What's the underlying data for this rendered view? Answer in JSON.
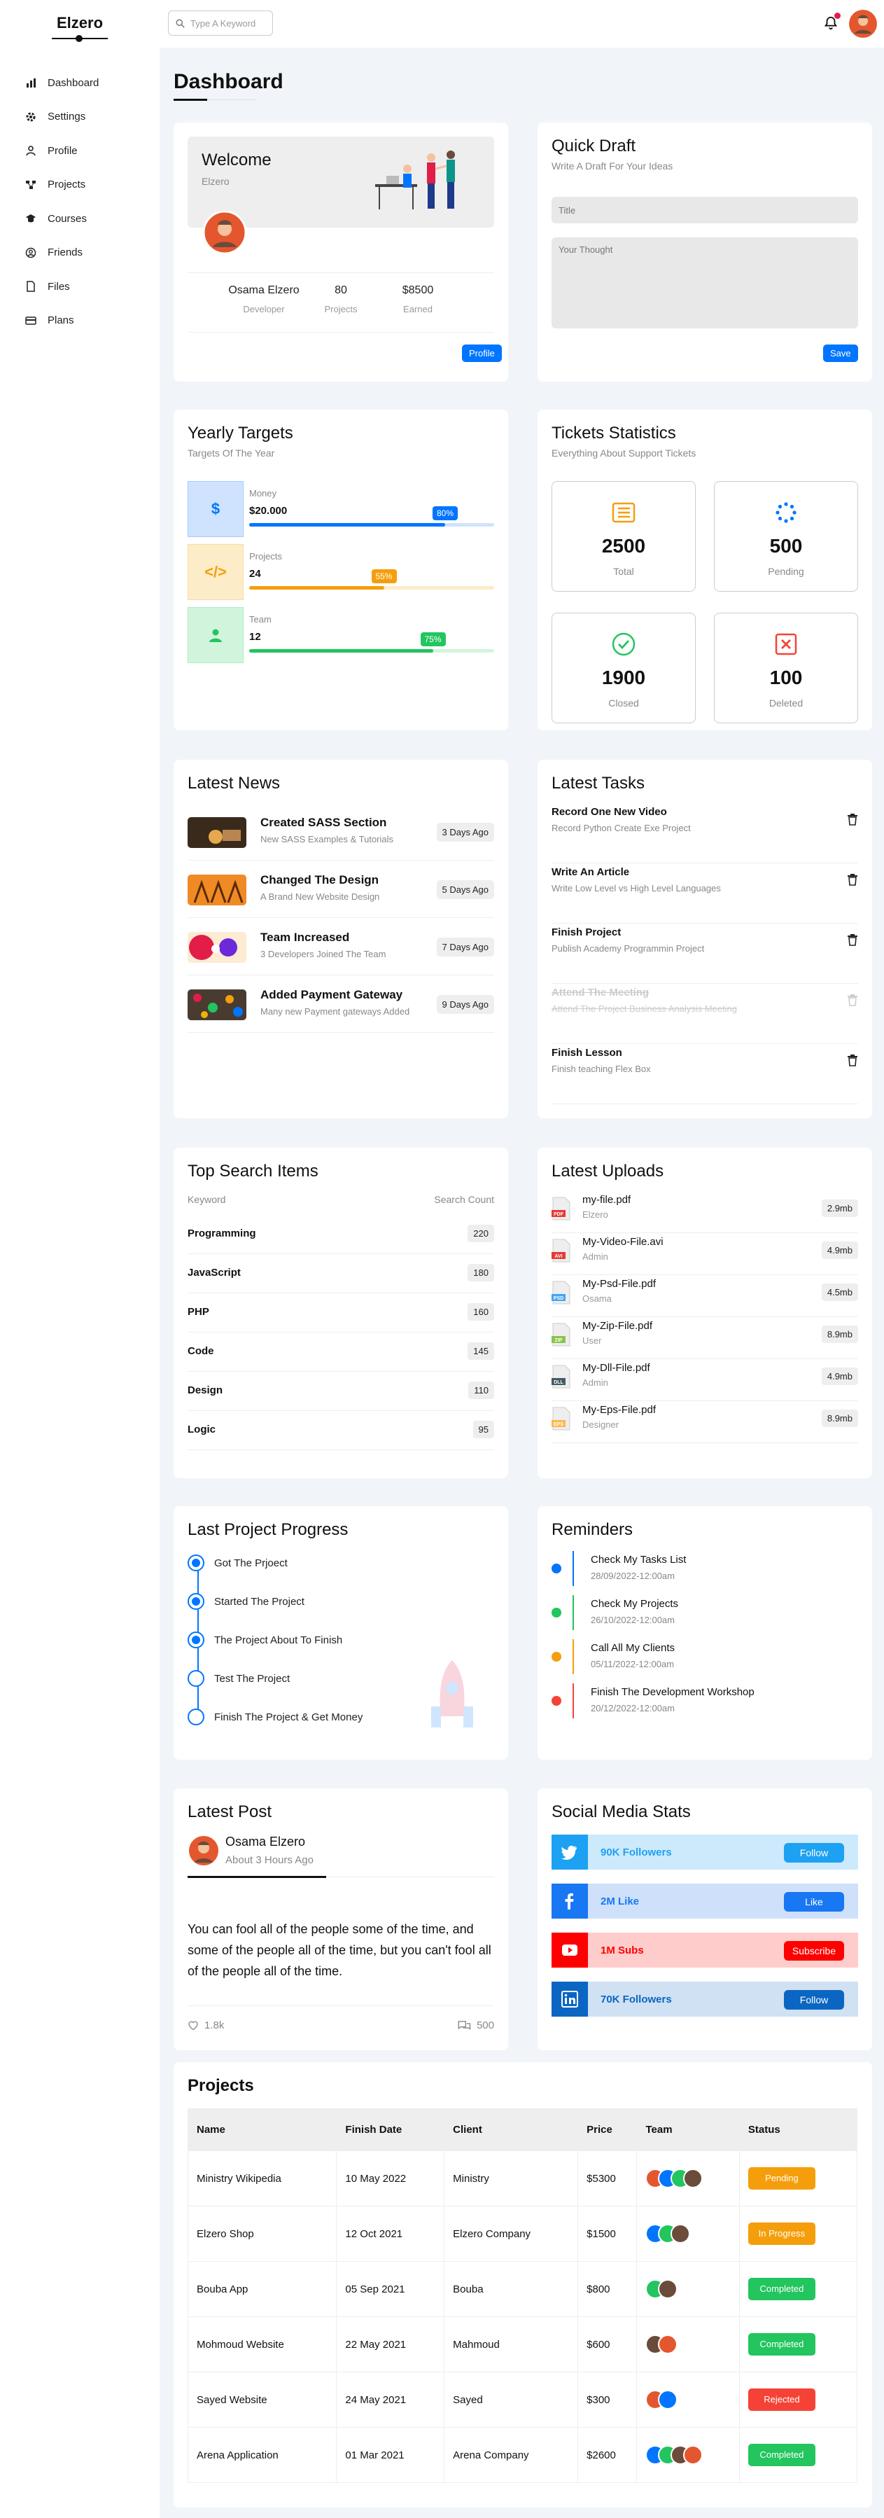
{
  "brand": "Elzero",
  "sidebar": {
    "items": [
      {
        "label": "Dashboard",
        "icon": "chart-bar-icon"
      },
      {
        "label": "Settings",
        "icon": "gear-icon"
      },
      {
        "label": "Profile",
        "icon": "user-icon"
      },
      {
        "label": "Projects",
        "icon": "diagram-icon"
      },
      {
        "label": "Courses",
        "icon": "graduation-cap-icon"
      },
      {
        "label": "Friends",
        "icon": "circle-user-icon"
      },
      {
        "label": "Files",
        "icon": "file-icon"
      },
      {
        "label": "Plans",
        "icon": "credit-card-icon"
      }
    ]
  },
  "header": {
    "search_placeholder": "Type A Keyword"
  },
  "page": {
    "title": "Dashboard"
  },
  "welcome": {
    "title": "Welcome",
    "subtitle": "Elzero",
    "stats": [
      {
        "value": "Osama Elzero",
        "label": "Developer"
      },
      {
        "value": "80",
        "label": "Projects"
      },
      {
        "value": "$8500",
        "label": "Earned"
      }
    ],
    "button": "Profile"
  },
  "quick_draft": {
    "title": "Quick Draft",
    "subtitle": "Write A Draft For Your Ideas",
    "title_placeholder": "Title",
    "thought_placeholder": "Your Thought",
    "button": "Save"
  },
  "targets": {
    "title": "Yearly Targets",
    "subtitle": "Targets Of The Year",
    "items": [
      {
        "label": "Money",
        "value": "$20.000",
        "percent": 80,
        "badge": "80%",
        "color": "#0075ff",
        "bg": "#cfe3ff",
        "icon": "dollar-icon",
        "glyph": "$"
      },
      {
        "label": "Projects",
        "value": "24",
        "percent": 55,
        "badge": "55%",
        "color": "#f59e0b",
        "bg": "#fdecc8",
        "icon": "code-icon",
        "glyph": "</>"
      },
      {
        "label": "Team",
        "value": "12",
        "percent": 75,
        "badge": "75%",
        "color": "#22c55e",
        "bg": "#d1f5dc",
        "icon": "user-icon",
        "glyph": ""
      }
    ]
  },
  "tickets": {
    "title": "Tickets Statistics",
    "subtitle": "Everything About Support Tickets",
    "items": [
      {
        "value": "2500",
        "label": "Total",
        "icon": "list-icon",
        "color": "#f59e0b"
      },
      {
        "value": "500",
        "label": "Pending",
        "icon": "spinner-icon",
        "color": "#0075ff"
      },
      {
        "value": "1900",
        "label": "Closed",
        "icon": "check-circle-icon",
        "color": "#22c55e"
      },
      {
        "value": "100",
        "label": "Deleted",
        "icon": "x-square-icon",
        "color": "#f44336"
      }
    ]
  },
  "news": {
    "title": "Latest News",
    "items": [
      {
        "title": "Created SASS Section",
        "sub": "New SASS Examples & Tutorials",
        "time": "3 Days Ago"
      },
      {
        "title": "Changed The Design",
        "sub": "A Brand New Website Design",
        "time": "5 Days Ago"
      },
      {
        "title": "Team Increased",
        "sub": "3 Developers Joined The Team",
        "time": "7 Days Ago"
      },
      {
        "title": "Added Payment Gateway",
        "sub": "Many new Payment gateways Added",
        "time": "9 Days Ago"
      }
    ]
  },
  "tasks": {
    "title": "Latest Tasks",
    "items": [
      {
        "title": "Record One New Video",
        "sub": "Record Python Create Exe Project",
        "done": false
      },
      {
        "title": "Write An Article",
        "sub": "Write Low Level vs High Level Languages",
        "done": false
      },
      {
        "title": "Finish Project",
        "sub": "Publish Academy Programmin Project",
        "done": false
      },
      {
        "title": "Attend The Meeting",
        "sub": "Attend The Project Business Analysis Meeting",
        "done": true
      },
      {
        "title": "Finish Lesson",
        "sub": "Finish teaching Flex Box",
        "done": false
      }
    ]
  },
  "search_items": {
    "title": "Top Search Items",
    "col_keyword": "Keyword",
    "col_count": "Search Count",
    "rows": [
      {
        "k": "Programming",
        "c": "220"
      },
      {
        "k": "JavaScript",
        "c": "180"
      },
      {
        "k": "PHP",
        "c": "160"
      },
      {
        "k": "Code",
        "c": "145"
      },
      {
        "k": "Design",
        "c": "110"
      },
      {
        "k": "Logic",
        "c": "95"
      }
    ]
  },
  "uploads": {
    "title": "Latest Uploads",
    "rows": [
      {
        "name": "my-file.pdf",
        "owner": "Elzero",
        "size": "2.9mb",
        "ext": "PDF",
        "color": "#e53935"
      },
      {
        "name": "My-Video-File.avi",
        "owner": "Admin",
        "size": "4.9mb",
        "ext": "AVI",
        "color": "#e53935"
      },
      {
        "name": "My-Psd-File.pdf",
        "owner": "Osama",
        "size": "4.5mb",
        "ext": "PSD",
        "color": "#42a5f5"
      },
      {
        "name": "My-Zip-File.pdf",
        "owner": "User",
        "size": "8.9mb",
        "ext": "ZIP",
        "color": "#8bc34a"
      },
      {
        "name": "My-Dll-File.pdf",
        "owner": "Admin",
        "size": "4.9mb",
        "ext": "DLL",
        "color": "#455a64"
      },
      {
        "name": "My-Eps-File.pdf",
        "owner": "Designer",
        "size": "8.9mb",
        "ext": "EPS",
        "color": "#ffb74d"
      }
    ]
  },
  "progress": {
    "title": "Last Project Progress",
    "items": [
      {
        "label": "Got The Prjoect",
        "done": true
      },
      {
        "label": "Started The Project",
        "done": true
      },
      {
        "label": "The Project About To Finish",
        "done": true
      },
      {
        "label": "Test The Project",
        "done": false
      },
      {
        "label": "Finish The Project & Get Money",
        "done": false
      }
    ]
  },
  "reminders": {
    "title": "Reminders",
    "items": [
      {
        "title": "Check My Tasks List",
        "date": "28/09/2022-12:00am",
        "color": "#0075ff"
      },
      {
        "title": "Check My Projects",
        "date": "26/10/2022-12:00am",
        "color": "#22c55e"
      },
      {
        "title": "Call All My Clients",
        "date": "05/11/2022-12:00am",
        "color": "#f59e0b"
      },
      {
        "title": "Finish The Development Workshop",
        "date": "20/12/2022-12:00am",
        "color": "#f44336"
      }
    ]
  },
  "post": {
    "title": "Latest Post",
    "author": "Osama Elzero",
    "time": "About 3 Hours Ago",
    "text": "You can fool all of the people some of the time, and some of the people all of the time, but you can't fool all of the people all of the time.",
    "likes": "1.8k",
    "comments": "500"
  },
  "social": {
    "title": "Social Media Stats",
    "items": [
      {
        "text": "90K Followers",
        "button": "Follow",
        "icon": "twitter-icon",
        "main": "#1da1f2",
        "light": "#cde9fc"
      },
      {
        "text": "2M Like",
        "button": "Like",
        "icon": "facebook-icon",
        "main": "#1877f2",
        "light": "#cfe0fb"
      },
      {
        "text": "1M Subs",
        "button": "Subscribe",
        "icon": "youtube-icon",
        "main": "#ff0000",
        "light": "#ffcccc"
      },
      {
        "text": "70K Followers",
        "button": "Follow",
        "icon": "linkedin-icon",
        "main": "#0a66c2",
        "light": "#cfe1f3"
      }
    ]
  },
  "projects": {
    "title": "Projects",
    "columns": [
      "Name",
      "Finish Date",
      "Client",
      "Price",
      "Team",
      "Status"
    ],
    "rows": [
      {
        "name": "Ministry Wikipedia",
        "date": "10 May 2022",
        "client": "Ministry",
        "price": "$5300",
        "team": 4,
        "status": "Pending",
        "color": "#f59e0b"
      },
      {
        "name": "Elzero Shop",
        "date": "12 Oct 2021",
        "client": "Elzero Company",
        "price": "$1500",
        "team": 3,
        "status": "In Progress",
        "color": "#f59e0b"
      },
      {
        "name": "Bouba App",
        "date": "05 Sep 2021",
        "client": "Bouba",
        "price": "$800",
        "team": 2,
        "status": "Completed",
        "color": "#22c55e"
      },
      {
        "name": "Mohmoud Website",
        "date": "22 May 2021",
        "client": "Mahmoud",
        "price": "$600",
        "team": 2,
        "status": "Completed",
        "color": "#22c55e"
      },
      {
        "name": "Sayed Website",
        "date": "24 May 2021",
        "client": "Sayed",
        "price": "$300",
        "team": 2,
        "status": "Rejected",
        "color": "#f44336"
      },
      {
        "name": "Arena Application",
        "date": "01 Mar 2021",
        "client": "Arena Company",
        "price": "$2600",
        "team": 4,
        "status": "Completed",
        "color": "#22c55e"
      }
    ]
  }
}
